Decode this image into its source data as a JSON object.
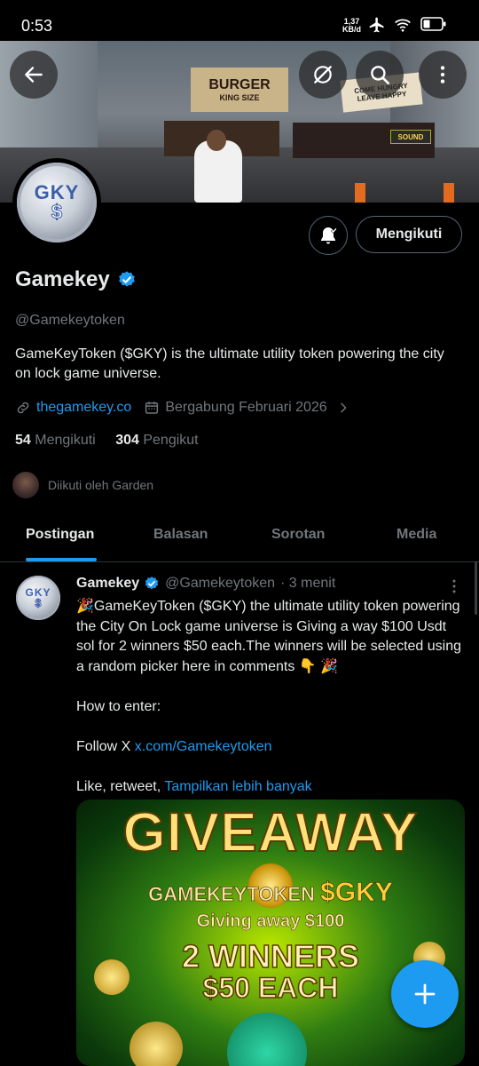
{
  "status_bar": {
    "time": "0:53",
    "speed_value": "1,37",
    "speed_unit": "KB/d"
  },
  "banner": {
    "sign_burger": "BURGER",
    "sign_king": "KING SIZE",
    "sign_come": "COME HUNGRY",
    "sign_leave": "LEAVE HAPPY",
    "sign_sound": "SOUND"
  },
  "header_icons": [
    "back-arrow-icon",
    "grok-icon",
    "search-icon",
    "more-vert-icon"
  ],
  "profile": {
    "avatar_text": "GKY",
    "avatar_symbol": "$",
    "name": "Gamekey",
    "handle": "@Gamekeytoken",
    "bio": "GameKeyToken ($GKY) is the ultimate utility token powering the city on lock game universe.",
    "website": "thegamekey.co",
    "joined": "Bergabung Februari 2026",
    "following_count": "54",
    "following_label": "Mengikuti",
    "followers_count": "304",
    "followers_label": "Pengikut",
    "followed_by": "Diikuti oleh Garden",
    "follow_button": "Mengikuti"
  },
  "tabs": [
    {
      "label": "Postingan",
      "active": true
    },
    {
      "label": "Balasan",
      "active": false
    },
    {
      "label": "Sorotan",
      "active": false
    },
    {
      "label": "Media",
      "active": false
    }
  ],
  "post": {
    "author": "Gamekey",
    "handle": "@Gamekeytoken",
    "time": "· 3 menit",
    "line1": "🎉GameKeyToken ($GKY) the ultimate utility token powering the City On Lock game universe is Giving a way $100 Usdt sol for 2 winners $50 each.The winners will be selected using a random picker here in comments 👇 🎉",
    "line2": "How to enter:",
    "line3_prefix": "Follow X ",
    "line3_link": "x.com/Gamekeytoken",
    "line4_prefix": "Like, retweet, ",
    "line4_link": "Tampilkan lebih banyak",
    "image": {
      "title": "GIVEAWAY",
      "brand": "GAMEKEYTOKEN",
      "ticker": "$GKY",
      "giving": "Giving away $100",
      "winners": "2 WINNERS",
      "each": "$50 EACH"
    }
  },
  "colors": {
    "accent": "#1d9bf0",
    "background": "#000000",
    "muted": "#71767b"
  }
}
